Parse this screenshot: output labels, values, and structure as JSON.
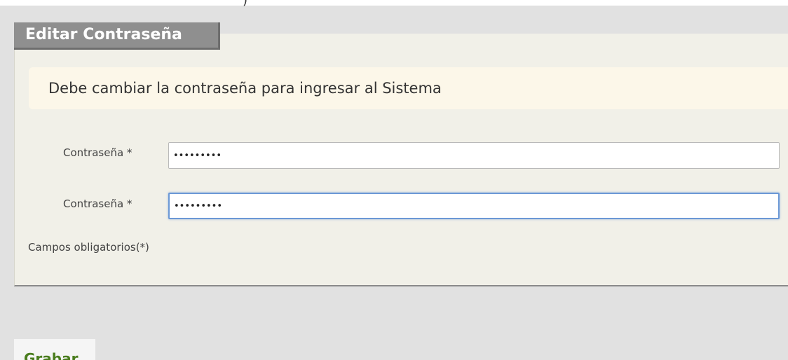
{
  "header": {
    "partial_text": ")"
  },
  "form": {
    "title": "Editar Contraseña",
    "notice": "Debe cambiar la contraseña para ingresar al Sistema",
    "fields": [
      {
        "label": "Contraseña *",
        "value": "•••••••••"
      },
      {
        "label": "Contraseña *",
        "value": "•••••••••"
      }
    ],
    "required_note": "Campos obligatorios(*)"
  },
  "actions": {
    "save_label": "Grabar"
  },
  "colors": {
    "title_bar": "#8f8f8f",
    "panel": "#f1f0e8",
    "notice": "#fcf7e9",
    "focus_border": "#6b98d6",
    "save_text": "#4a7d1e"
  }
}
